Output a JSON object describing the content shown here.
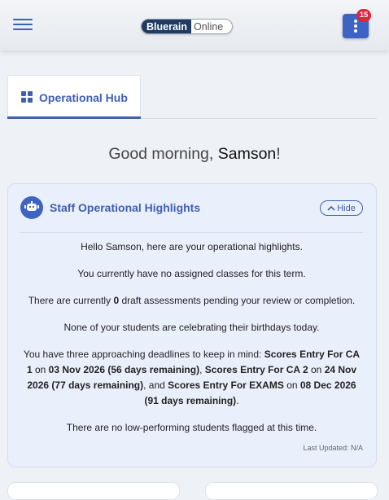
{
  "header": {
    "logo_left": "Bluerain",
    "logo_right": "Online",
    "notification_count": "15"
  },
  "tabs": [
    {
      "label": "Operational Hub",
      "icon": "grid-icon"
    }
  ],
  "greeting": {
    "prefix": "Good morning, ",
    "name": "Samson",
    "suffix": "!"
  },
  "highlights": {
    "title": "Staff Operational Highlights",
    "hide_label": "Hide",
    "intro": "Hello Samson, here are your operational highlights.",
    "classes": "You currently have no assigned classes for this term.",
    "drafts_before": "There are currently ",
    "drafts_count": "0",
    "drafts_after": " draft assessments pending your review or completion.",
    "birthdays": "None of your students are celebrating their birthdays today.",
    "deadlines": {
      "lead": "You have three approaching deadlines to keep in mind: ",
      "d1_name": "Scores Entry For CA 1",
      "on1": " on ",
      "d1_date": "03 Nov 2026 (56 days remaining)",
      "sep1": ", ",
      "d2_name": "Scores Entry For CA 2",
      "on2": " on ",
      "d2_date": "24 Nov 2026 (77 days remaining)",
      "sep2": ", and ",
      "d3_name": "Scores Entry For EXAMS",
      "on3": " on ",
      "d3_date": "08 Dec 2026 (91 days remaining)",
      "end": "."
    },
    "low_performing": "There are no low-performing students flagged at this time.",
    "last_updated": "Last Updated: N/A"
  },
  "colors": {
    "accent": "#3f5eb5",
    "badge": "#e0243a",
    "card_bg": "#eaf0fb",
    "logo_dark": "#1f3b63"
  }
}
